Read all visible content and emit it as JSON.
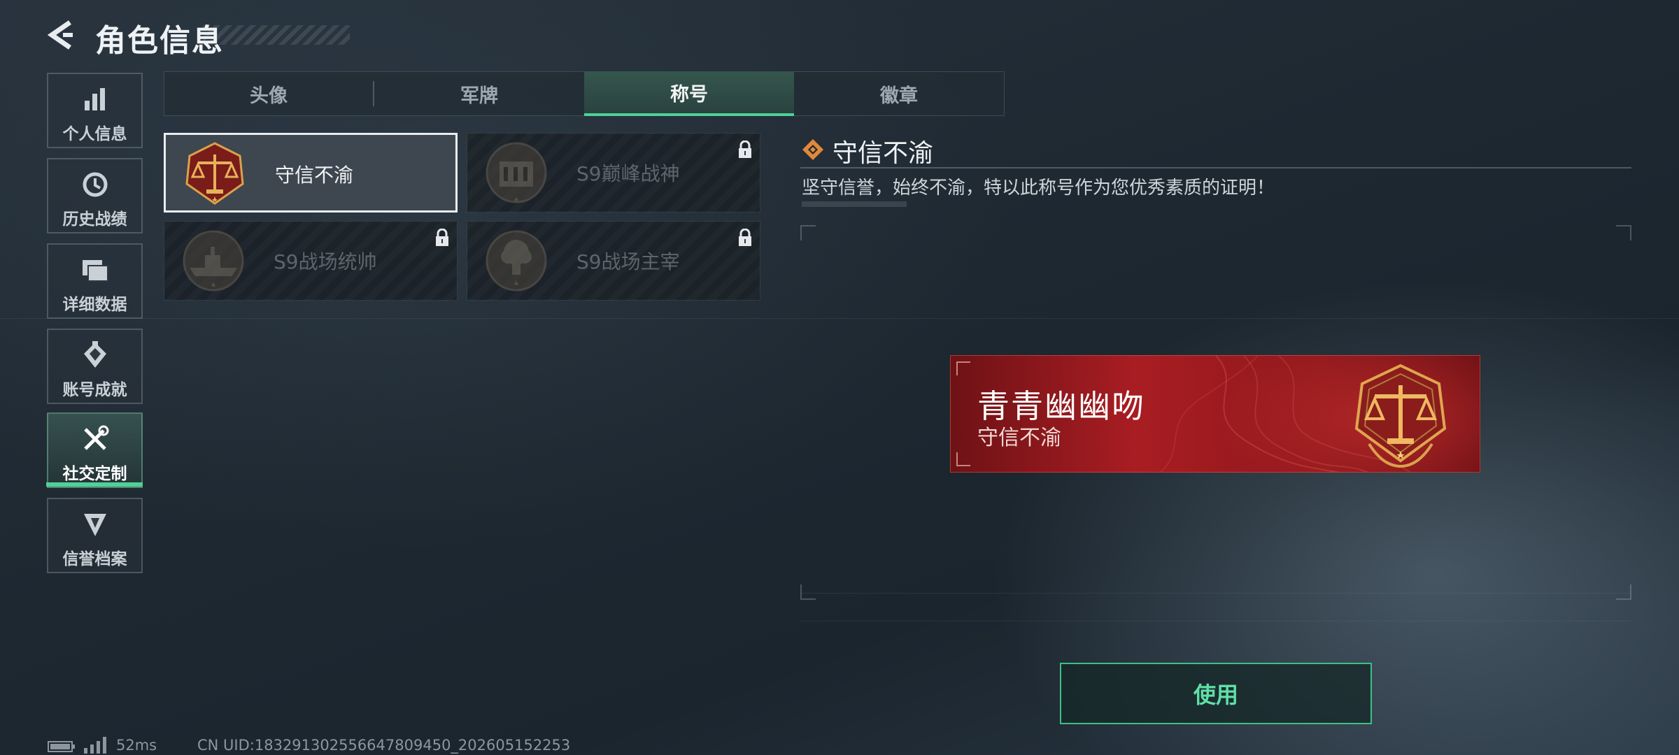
{
  "header": {
    "title": "角色信息"
  },
  "sidebar": {
    "items": [
      {
        "label": "个人信息",
        "icon": "bar-chart-icon"
      },
      {
        "label": "历史战绩",
        "icon": "history-icon"
      },
      {
        "label": "详细数据",
        "icon": "folder-icon"
      },
      {
        "label": "账号成就",
        "icon": "achievement-icon"
      },
      {
        "label": "社交定制",
        "icon": "tools-icon",
        "active": true
      },
      {
        "label": "信誉档案",
        "icon": "credit-icon"
      }
    ]
  },
  "tabs": [
    {
      "label": "头像"
    },
    {
      "label": "军牌"
    },
    {
      "label": "称号",
      "active": true
    },
    {
      "label": "徽章"
    }
  ],
  "titles": [
    {
      "name": "守信不渝",
      "selected": true,
      "locked": false,
      "emblem": "scales-emblem-icon"
    },
    {
      "name": "S9巅峰战神",
      "selected": false,
      "locked": true,
      "emblem": "fortress-emblem-icon"
    },
    {
      "name": "S9战场统帅",
      "selected": false,
      "locked": true,
      "emblem": "warship-emblem-icon"
    },
    {
      "name": "S9战场主宰",
      "selected": false,
      "locked": true,
      "emblem": "explosion-emblem-icon"
    }
  ],
  "detail": {
    "title": "守信不渝",
    "description": "坚守信誉，始终不渝，特以此称号作为您优秀素质的证明！"
  },
  "preview": {
    "player_name": "青青幽幽吻",
    "title": "守信不渝"
  },
  "actions": {
    "use_label": "使用"
  },
  "footer": {
    "ping": "52ms",
    "uid": "CN UID:183291302556647809450_202605152253"
  },
  "colors": {
    "accent": "#4fd196",
    "plate_red": "#a81d22",
    "emblem_gold": "#d9a24a"
  }
}
